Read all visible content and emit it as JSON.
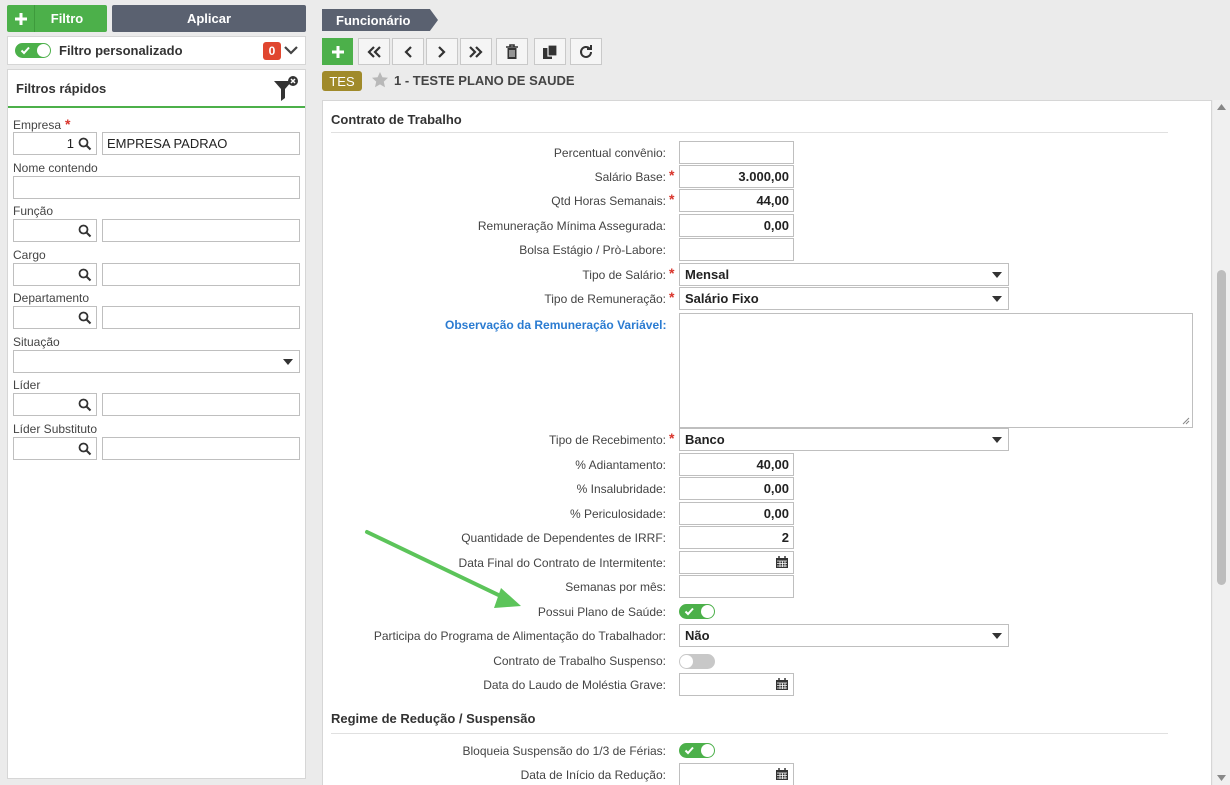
{
  "filter_panel": {
    "filtro_label": "Filtro",
    "aplicar_label": "Aplicar",
    "custom_filter_label": "Filtro personalizado",
    "custom_filter_enabled": true,
    "custom_filter_count": "0",
    "quick_filters_title": "Filtros rápidos",
    "fields": {
      "empresa": {
        "label": "Empresa",
        "code": "1",
        "description": "EMPRESA PADRAO"
      },
      "nome": {
        "label": "Nome contendo"
      },
      "funcao": {
        "label": "Função"
      },
      "cargo": {
        "label": "Cargo"
      },
      "departamento": {
        "label": "Departamento"
      },
      "situacao": {
        "label": "Situação"
      },
      "lider": {
        "label": "Líder"
      },
      "lider_substituto": {
        "label": "Líder Substituto"
      }
    }
  },
  "record": {
    "tab_label": "Funcionário",
    "tag": "TES",
    "title": "1 - TESTE PLANO DE SAUDE"
  },
  "contrato": {
    "section_title": "Contrato de Trabalho",
    "percentual_convenio": {
      "label": "Percentual convênio:",
      "value": ""
    },
    "salario_base": {
      "label": "Salário Base:",
      "value": "3.000,00"
    },
    "qtd_horas": {
      "label": "Qtd Horas Semanais:",
      "value": "44,00"
    },
    "remuneracao_minima": {
      "label": "Remuneração Mínima Assegurada:",
      "value": "0,00"
    },
    "bolsa_estagio": {
      "label": "Bolsa Estágio / Prò-Labore:",
      "value": ""
    },
    "tipo_salario": {
      "label": "Tipo de Salário:",
      "value": "Mensal"
    },
    "tipo_remuneracao": {
      "label": "Tipo de Remuneração:",
      "value": "Salário Fixo"
    },
    "observacao": {
      "label": "Observação da Remuneração Variável:",
      "value": ""
    },
    "tipo_recebimento": {
      "label": "Tipo de Recebimento:",
      "value": "Banco"
    },
    "adiantamento": {
      "label": "% Adiantamento:",
      "value": "40,00"
    },
    "insalubridade": {
      "label": "% Insalubridade:",
      "value": "0,00"
    },
    "periculosidade": {
      "label": "% Periculosidade:",
      "value": "0,00"
    },
    "dependentes_irrf": {
      "label": "Quantidade de Dependentes de IRRF:",
      "value": "2"
    },
    "data_final_intermitente": {
      "label": "Data Final do Contrato de Intermitente:",
      "value": ""
    },
    "semanas_mes": {
      "label": "Semanas por mês:",
      "value": ""
    },
    "plano_saude": {
      "label": "Possui Plano de Saúde:",
      "enabled": true
    },
    "pat": {
      "label": "Participa do Programa de Alimentação do Trabalhador:",
      "value": "Não"
    },
    "contrato_suspenso": {
      "label": "Contrato de Trabalho Suspenso:",
      "enabled": false
    },
    "laudo_molestia": {
      "label": "Data do Laudo de Moléstia Grave:",
      "value": ""
    }
  },
  "regime": {
    "section_title": "Regime de Redução / Suspensão",
    "bloqueia_ferias": {
      "label": "Bloqueia Suspensão do 1/3 de Férias:",
      "enabled": true
    },
    "data_inicio_reducao": {
      "label": "Data de Início da Redução:",
      "value": ""
    }
  },
  "colors": {
    "accent_green": "#4cb04a",
    "dark_button": "#5a6170",
    "required": "#d9342b",
    "link_blue": "#2a7bd1",
    "arrow_green": "#5cc45a"
  }
}
